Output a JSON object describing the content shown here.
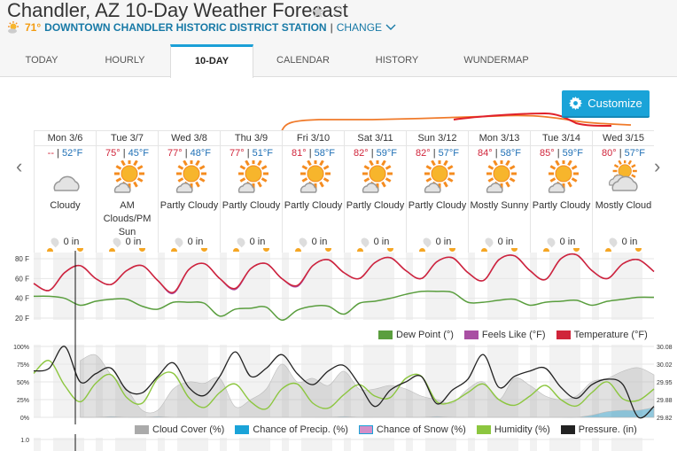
{
  "header": {
    "title": "Chandler, AZ 10-Day Weather Forecast",
    "current_temp": "71°",
    "station": "DOWNTOWN CHANDLER HISTORIC DISTRICT STATION",
    "separator": "|",
    "change": "CHANGE"
  },
  "tabs": [
    {
      "label": "TODAY"
    },
    {
      "label": "HOURLY"
    },
    {
      "label": "10-DAY",
      "active": true
    },
    {
      "label": "CALENDAR"
    },
    {
      "label": "HISTORY"
    },
    {
      "label": "WUNDERMAP"
    }
  ],
  "customize_label": "Customize",
  "colors": {
    "accent": "#1aa3d8",
    "high": "#d0243a",
    "low": "#1e6fb5",
    "temperature": "#d0243a",
    "feels_like": "#a94fa3",
    "dew_point": "#5a9e3e",
    "humidity": "#8cc63f",
    "pressure": "#222222",
    "cloud": "#aaaaaa",
    "precip": "#1aa3d8",
    "snow": "#d48fc8"
  },
  "days": [
    {
      "day": "Mon 3/6",
      "high": "--",
      "low": "52°F",
      "icon": "cloudy",
      "condition": "Cloudy",
      "precip": "0 in"
    },
    {
      "day": "Tue 3/7",
      "high": "75°",
      "low": "45°F",
      "icon": "partly-cloudy",
      "condition": "AM Clouds/PM Sun",
      "precip": "0 in"
    },
    {
      "day": "Wed 3/8",
      "high": "77°",
      "low": "48°F",
      "icon": "partly-cloudy",
      "condition": "Partly Cloudy",
      "precip": "0 in"
    },
    {
      "day": "Thu 3/9",
      "high": "77°",
      "low": "51°F",
      "icon": "partly-cloudy",
      "condition": "Partly Cloudy",
      "precip": "0 in"
    },
    {
      "day": "Fri 3/10",
      "high": "81°",
      "low": "58°F",
      "icon": "partly-cloudy",
      "condition": "Partly Cloudy",
      "precip": "0 in"
    },
    {
      "day": "Sat 3/11",
      "high": "82°",
      "low": "59°F",
      "icon": "partly-cloudy",
      "condition": "Partly Cloudy",
      "precip": "0 in"
    },
    {
      "day": "Sun 3/12",
      "high": "82°",
      "low": "57°F",
      "icon": "partly-cloudy",
      "condition": "Partly Cloudy",
      "precip": "0 in"
    },
    {
      "day": "Mon 3/13",
      "high": "84°",
      "low": "58°F",
      "icon": "mostly-sunny",
      "condition": "Mostly Sunny",
      "precip": "0 in"
    },
    {
      "day": "Tue 3/14",
      "high": "85°",
      "low": "59°F",
      "icon": "partly-cloudy",
      "condition": "Partly Cloudy",
      "precip": "0 in"
    },
    {
      "day": "Wed 3/15",
      "high": "80°",
      "low": "57°F",
      "icon": "mostly-cloudy",
      "condition": "Mostly Cloud",
      "precip": "0 in"
    }
  ],
  "chart_data": [
    {
      "type": "line",
      "ylim": [
        15,
        85
      ],
      "yticks": [
        "80 F",
        "60 F",
        "40 F",
        "20 F"
      ],
      "ytick_values": [
        80,
        60,
        40,
        20
      ],
      "grid": true,
      "legend": "bottom-right",
      "series": [
        {
          "name": "Temperature (°F)",
          "values": [
            55,
            48,
            66,
            73,
            60,
            54,
            68,
            73,
            58,
            46,
            69,
            75,
            60,
            50,
            70,
            75,
            60,
            53,
            73,
            79,
            66,
            60,
            76,
            81,
            68,
            60,
            77,
            81,
            66,
            58,
            79,
            83,
            68,
            59,
            80,
            84,
            68,
            60,
            75,
            79,
            67
          ]
        },
        {
          "name": "Feels Like (°F)",
          "values": [
            55,
            48,
            66,
            73,
            60,
            54,
            68,
            73,
            58,
            45,
            69,
            75,
            60,
            49,
            70,
            75,
            60,
            52,
            73,
            79,
            66,
            60,
            76,
            81,
            68,
            60,
            77,
            81,
            66,
            58,
            79,
            83,
            68,
            59,
            80,
            84,
            68,
            60,
            75,
            79,
            67
          ]
        },
        {
          "name": "Dew Point (°)",
          "values": [
            42,
            42,
            40,
            33,
            37,
            39,
            39,
            32,
            29,
            36,
            36,
            35,
            22,
            29,
            30,
            31,
            18,
            28,
            32,
            32,
            24,
            35,
            37,
            40,
            44,
            47,
            47,
            46,
            36,
            36,
            38,
            39,
            33,
            36,
            37,
            38,
            33,
            37,
            39,
            41,
            41
          ]
        }
      ]
    },
    {
      "type": "area",
      "ylim": [
        0,
        100
      ],
      "yticks": [
        "100%",
        "75%",
        "50%",
        "25%",
        "0%"
      ],
      "y2ticks": [
        "30.08",
        "30.02",
        "29.95",
        "29.88",
        "29.82"
      ],
      "y2lim": [
        29.82,
        30.08
      ],
      "legend": "bottom-right",
      "series": [
        {
          "name": "Cloud Cover (%)",
          "values": [
            null,
            null,
            null,
            80,
            88,
            60,
            40,
            10,
            10,
            40,
            50,
            48,
            55,
            15,
            25,
            40,
            75,
            50,
            55,
            45,
            65,
            40,
            40,
            45,
            40,
            30,
            25,
            20,
            40,
            50,
            25,
            55,
            45,
            30,
            25,
            30,
            50,
            55,
            65,
            70,
            60
          ]
        },
        {
          "name": "Chance of Precip. (%)",
          "values": [
            null,
            null,
            null,
            0,
            0,
            1,
            0,
            0,
            1,
            0,
            0,
            0,
            0,
            0,
            0,
            0,
            0,
            0,
            0,
            0,
            1,
            0,
            0,
            0,
            0,
            0,
            1,
            0,
            0,
            0,
            0,
            0,
            0,
            0,
            0,
            0,
            3,
            8,
            10,
            10,
            14
          ]
        },
        {
          "name": "Chance of Snow (%)",
          "values": []
        },
        {
          "name": "Humidity (%)",
          "values": [
            62,
            80,
            45,
            22,
            48,
            60,
            28,
            20,
            55,
            62,
            28,
            14,
            35,
            47,
            22,
            12,
            40,
            47,
            20,
            13,
            32,
            46,
            30,
            28,
            55,
            58,
            22,
            22,
            35,
            47,
            25,
            17,
            30,
            45,
            25,
            16,
            35,
            50,
            26,
            24,
            40
          ]
        },
        {
          "name": "Pressure. (in)",
          "values": [
            29.99,
            30.0,
            30.08,
            29.95,
            29.98,
            30.0,
            29.92,
            29.91,
            29.97,
            30.02,
            29.93,
            29.9,
            29.97,
            30.06,
            29.97,
            30.0,
            30.05,
            29.98,
            29.94,
            29.99,
            30.01,
            29.94,
            29.86,
            29.92,
            29.95,
            29.97,
            29.87,
            29.92,
            29.96,
            30.05,
            29.93,
            29.97,
            29.99,
            30.0,
            29.93,
            29.89,
            29.94,
            29.96,
            29.94,
            29.82,
            29.86
          ]
        }
      ]
    },
    {
      "type": "line",
      "yticks": [
        "1.0"
      ]
    }
  ]
}
